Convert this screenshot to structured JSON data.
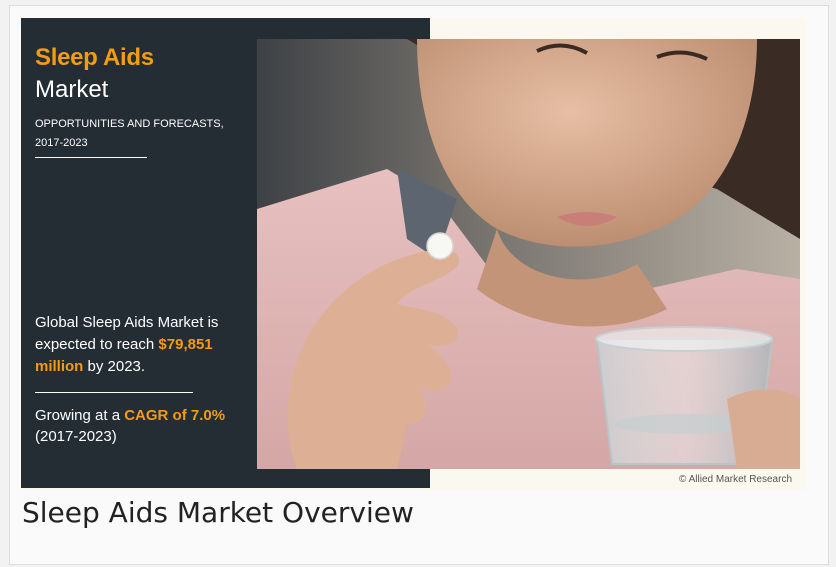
{
  "infographic": {
    "title_highlight": "Sleep Aids",
    "title_rest": "Market",
    "subtitle_line1": "OPPORTUNITIES AND FORECASTS,",
    "subtitle_line2": "2017-2023",
    "stat1_pre": "Global Sleep Aids Market is expected to reach ",
    "stat1_value": "$79,851 million",
    "stat1_post": " by 2023.",
    "stat2_pre": "Growing at a ",
    "stat2_value": "CAGR of 7.0%",
    "stat2_post": "(2017-2023)",
    "credit": "© Allied Market Research",
    "accent_color": "#f39c12",
    "panel_color": "#242c34"
  },
  "caption": "Sleep Aids Market Overview"
}
